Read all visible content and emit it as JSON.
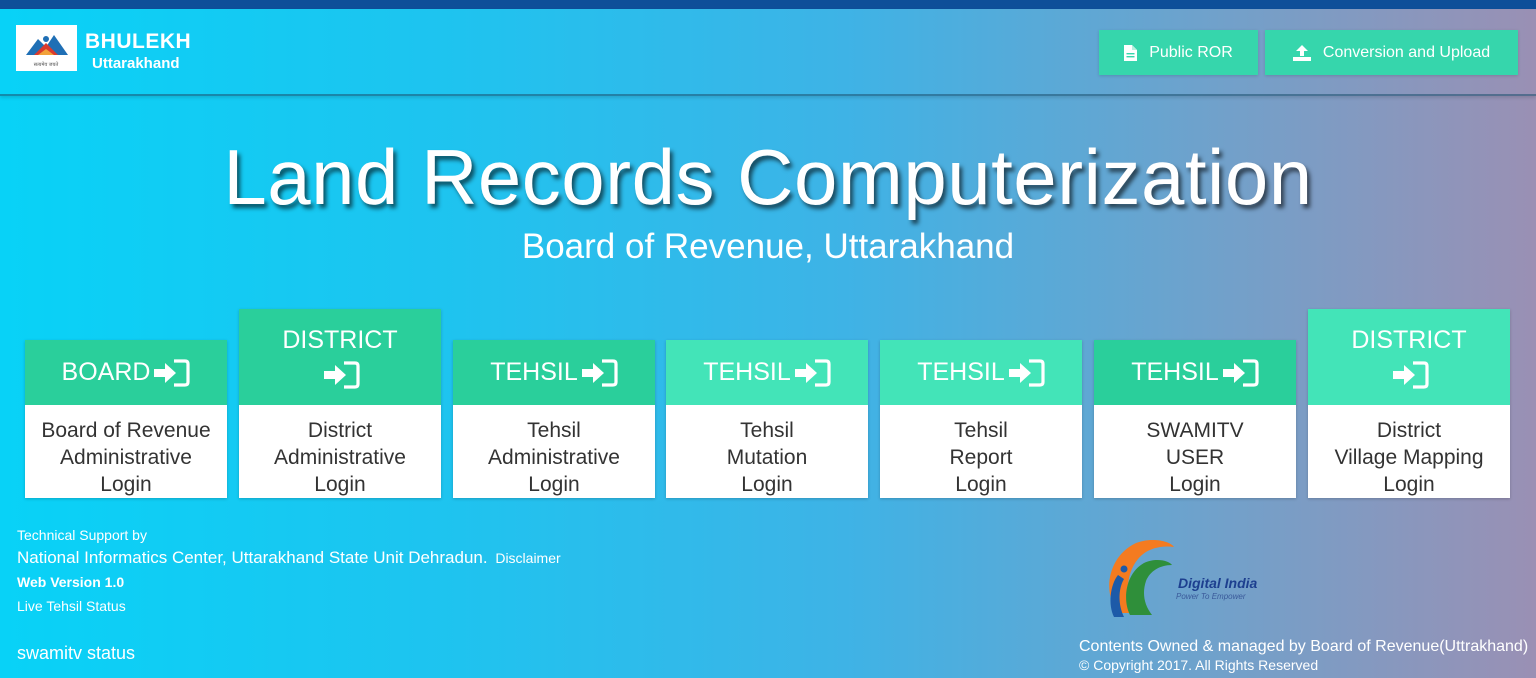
{
  "header": {
    "brand_title": "BHULEKH",
    "brand_subtitle": "Uttarakhand",
    "logo_caption": "सत्यमेव जयते",
    "buttons": [
      {
        "label": "Public ROR",
        "icon": "document-icon"
      },
      {
        "label": "Conversion and Upload",
        "icon": "upload-icon"
      }
    ]
  },
  "hero": {
    "title": "Land Records Computerization",
    "subtitle": "Board of Revenue, Uttarakhand"
  },
  "cards": [
    {
      "head": "BOARD",
      "lines": [
        "Board of Revenue",
        "Administrative",
        "Login"
      ]
    },
    {
      "head": "DISTRICT",
      "lines": [
        "District",
        "Administrative",
        "Login"
      ]
    },
    {
      "head": "TEHSIL",
      "lines": [
        "Tehsil",
        "Administrative",
        "Login"
      ]
    },
    {
      "head": "TEHSIL",
      "lines": [
        "Tehsil",
        "Mutation",
        "Login"
      ]
    },
    {
      "head": "TEHSIL",
      "lines": [
        "Tehsil",
        "Report",
        "Login"
      ]
    },
    {
      "head": "TEHSIL",
      "lines": [
        "SWAMITV",
        "USER",
        "Login"
      ]
    },
    {
      "head": "DISTRICT",
      "lines": [
        "District",
        "Village Mapping",
        "Login"
      ]
    }
  ],
  "footer": {
    "tech_support": "Technical Support by",
    "nic": "National Informatics Center, Uttarakhand State Unit Dehradun.",
    "disclaimer": "Disclaimer",
    "web_version": "Web Version 1.0",
    "live_status": "Live Tehsil Status",
    "swamitv_status": "swamitv status",
    "digital_india": "Digital India",
    "digital_india_tagline": "Power To Empower",
    "contents_owned": "Contents Owned & managed by Board of Revenue(Uttrakhand)",
    "copyright": "© Copyright 2017. All Rights Reserved"
  },
  "colors": {
    "card_head_dark": "#2acf9b",
    "card_head_light": "#43e4b8",
    "nav_button": "#36d6ac",
    "top_strip": "#0e4f99"
  }
}
